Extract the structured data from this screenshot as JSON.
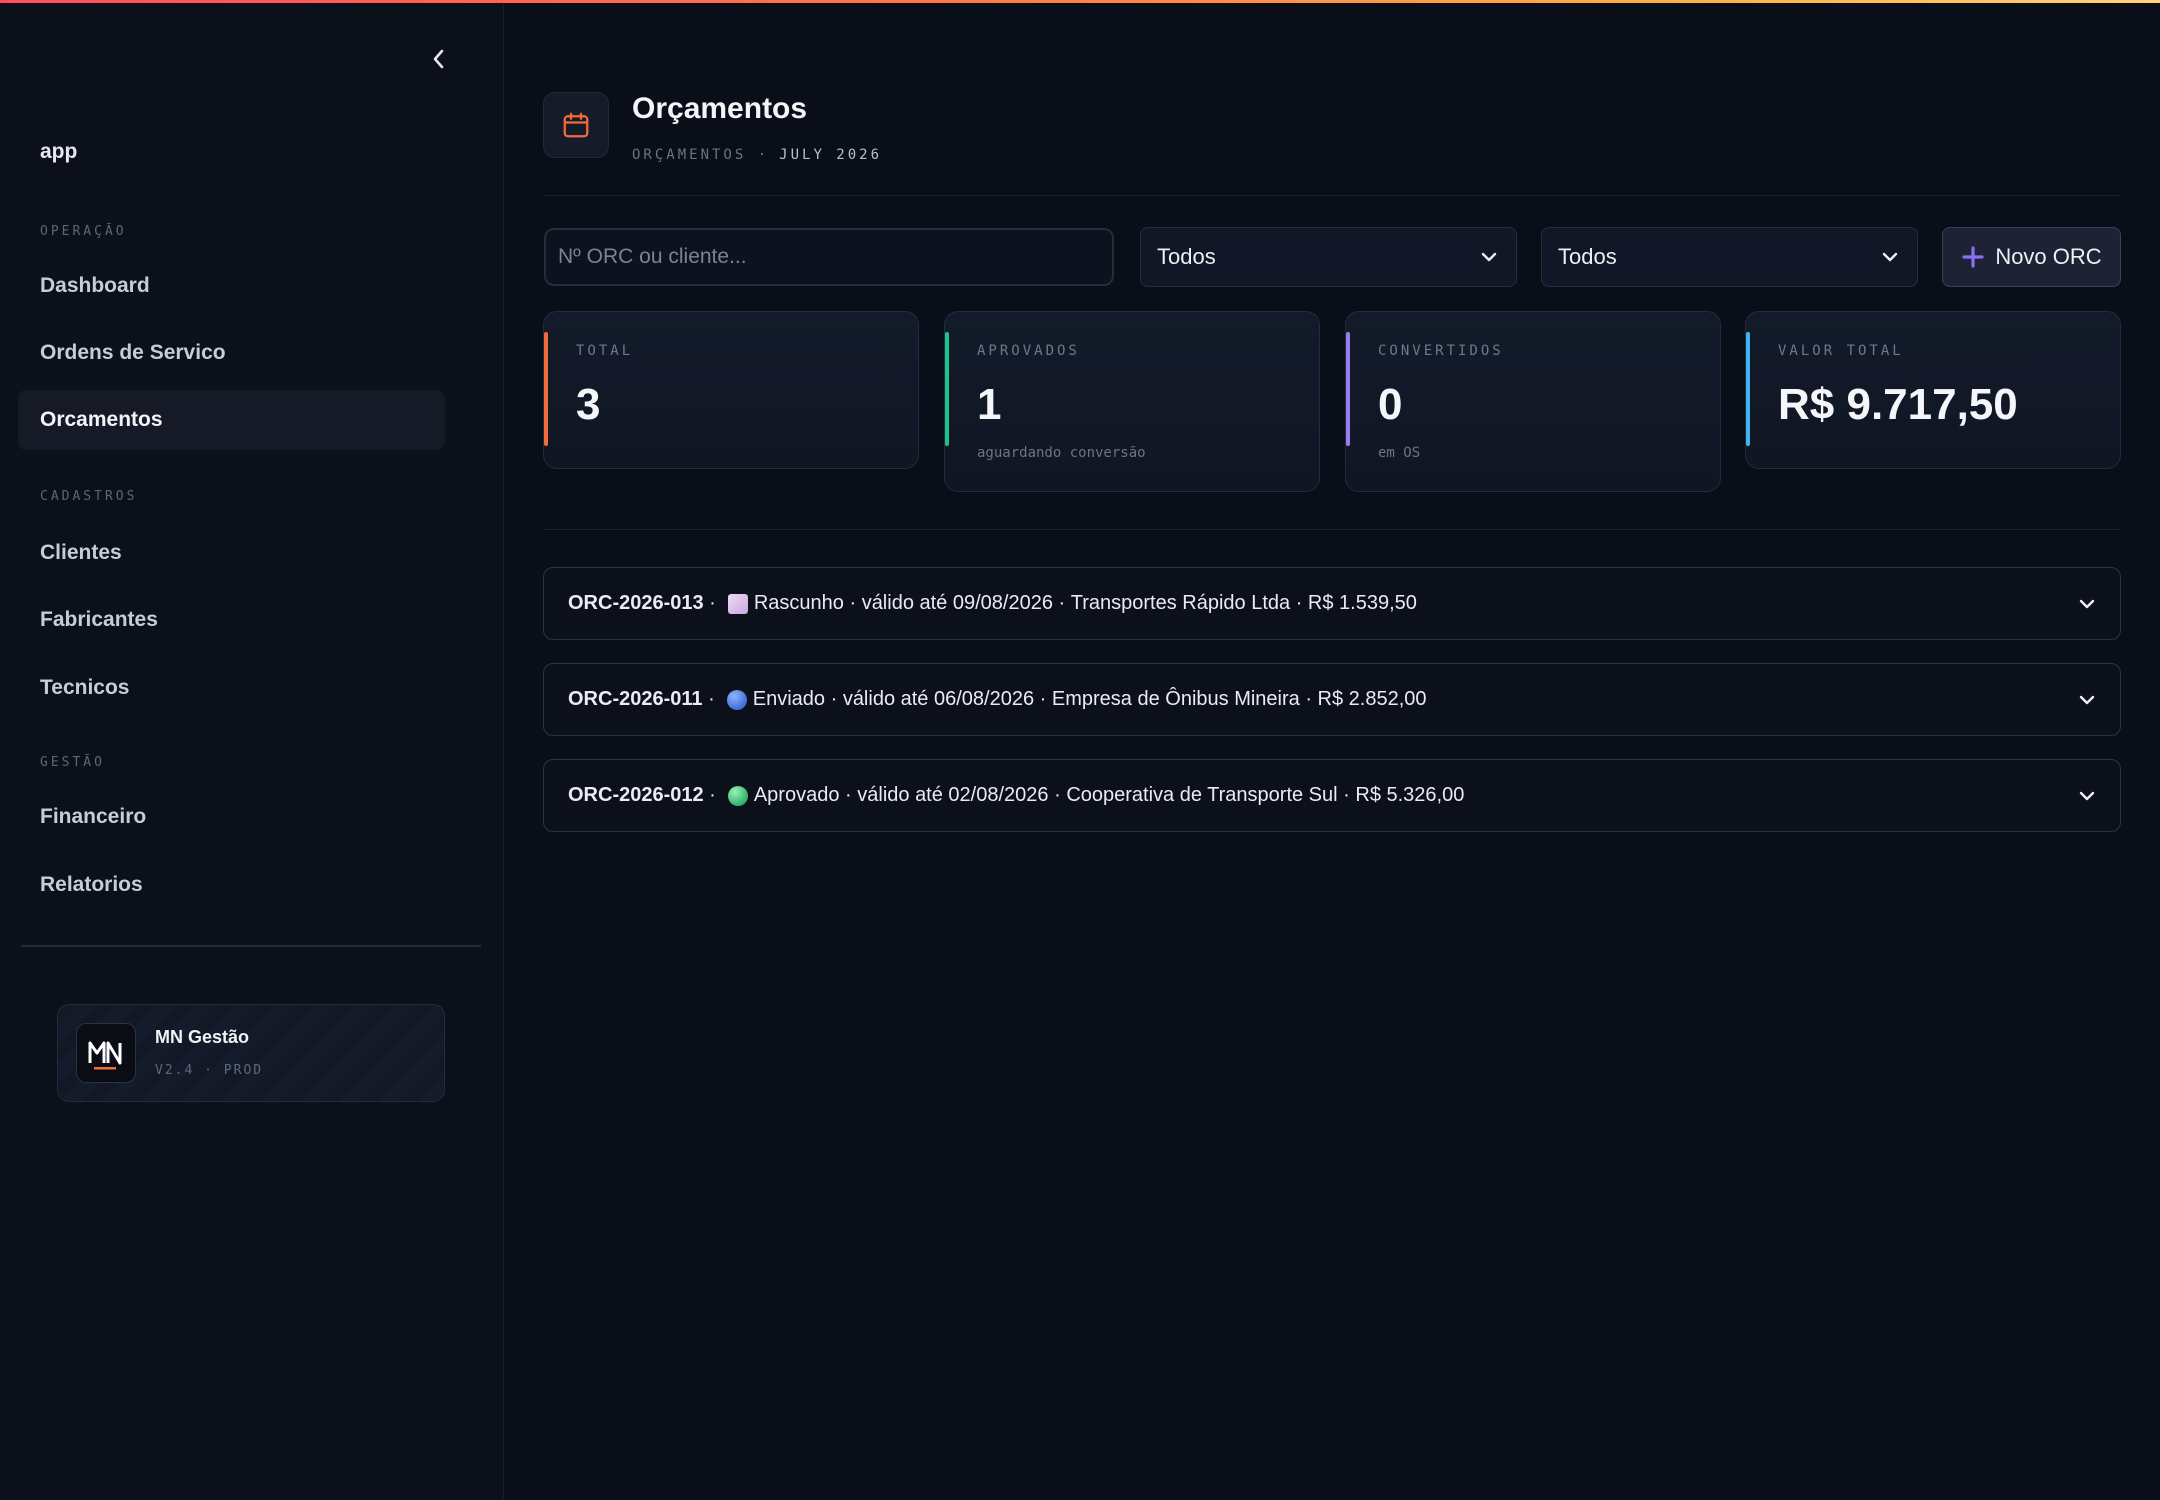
{
  "sidebar": {
    "app_label": "app",
    "sections": [
      {
        "title": "OPERAÇÃO",
        "items": [
          {
            "label": "Dashboard",
            "active": false
          },
          {
            "label": "Ordens de Servico",
            "active": false
          },
          {
            "label": "Orcamentos",
            "active": true
          }
        ]
      },
      {
        "title": "CADASTROS",
        "items": [
          {
            "label": "Clientes",
            "active": false
          },
          {
            "label": "Fabricantes",
            "active": false
          },
          {
            "label": "Tecnicos",
            "active": false
          }
        ]
      },
      {
        "title": "GESTÃO",
        "items": [
          {
            "label": "Financeiro",
            "active": false
          },
          {
            "label": "Relatorios",
            "active": false
          }
        ]
      }
    ],
    "brand": {
      "name": "MN Gestão",
      "version": "V2.4 · PROD",
      "logo_text": "MN"
    }
  },
  "header": {
    "title": "Orçamentos",
    "breadcrumb": "ORÇAMENTOS ·",
    "period": "JULY 2026",
    "icon": "calendar-icon"
  },
  "filters": {
    "search_placeholder": "Nº ORC ou cliente...",
    "status_select": "Todos",
    "client_select": "Todos",
    "new_button": "Novo ORC"
  },
  "stats": [
    {
      "label": "TOTAL",
      "value": "3",
      "sub": "",
      "color": "#f26b3a"
    },
    {
      "label": "APROVADOS",
      "value": "1",
      "sub": "aguardando conversão",
      "color": "#1fc28b"
    },
    {
      "label": "CONVERTIDOS",
      "value": "0",
      "sub": "em OS",
      "color": "#9b7bf0"
    },
    {
      "label": "VALOR TOTAL",
      "value": "R$ 9.717,50",
      "sub": "",
      "color": "#3fb4f0"
    }
  ],
  "orcamentos": [
    {
      "id": "ORC-2026-013",
      "status": "Rascunho",
      "status_icon": "square",
      "valid_until": "válido até 09/08/2026",
      "client": "Transportes Rápido Ltda",
      "value": "R$ 1.539,50"
    },
    {
      "id": "ORC-2026-011",
      "status": "Enviado",
      "status_icon": "blue-circle",
      "valid_until": "válido até 06/08/2026",
      "client": "Empresa de Ônibus Mineira",
      "value": "R$ 2.852,00"
    },
    {
      "id": "ORC-2026-012",
      "status": "Aprovado",
      "status_icon": "green-circle",
      "valid_until": "válido até 02/08/2026",
      "client": "Cooperativa de Transporte Sul",
      "value": "R$ 5.326,00"
    }
  ],
  "colors": {
    "accent": "#f26b3a",
    "background": "#0a0e18",
    "sidebar": "#0b101b"
  }
}
